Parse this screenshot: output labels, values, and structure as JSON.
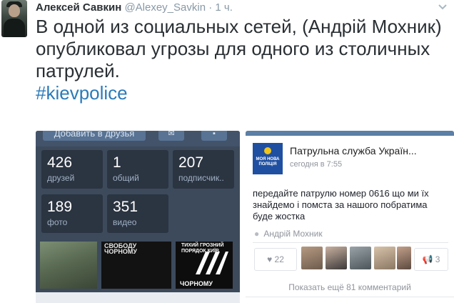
{
  "tweet": {
    "author": "Алексей Савкин",
    "handle": "@Alexey_Savkin",
    "separator": "·",
    "time": "1 ч.",
    "text": "В одной из социальных сетей, (Андрій Мохник) опубликовал угрозы для одного из столичных патрулей.",
    "hashtag": "#kievpolice",
    "menu_icon": "chevron-down-icon"
  },
  "vk_profile": {
    "add_button": "Добавить в друзья",
    "stats": [
      {
        "value": "426",
        "label": "друзей"
      },
      {
        "value": "1",
        "label": "общий"
      },
      {
        "value": "207",
        "label": "подписчик.."
      },
      {
        "value": "189",
        "label": "фото"
      },
      {
        "value": "351",
        "label": "видео"
      }
    ],
    "poster_text": "СВОБОДУ ЧОРНОМУ",
    "poster3_caption": "ТИХИЙ ГРОЗНИЙ ПОРЯДОК КИЇВ",
    "poster3_footer": "ЧОРНОМУ"
  },
  "fb_post": {
    "logo_text": "МОЯ НОВА ПОЛІЦІЯ",
    "page_name": "Патрульна служба Україн...",
    "date": "сегодня в 7:55",
    "comment": "передайте патрулю номер 0616 що ми їх знайдемо і помста за нашого побратима буде жостка",
    "author": "Андрій Мохник",
    "likes": "22",
    "shares": "3",
    "more_comments": "Показать ещё 81 комментарий",
    "colors": {
      "accent": "#5b7fa6",
      "logo": "#1f4fa0"
    }
  }
}
